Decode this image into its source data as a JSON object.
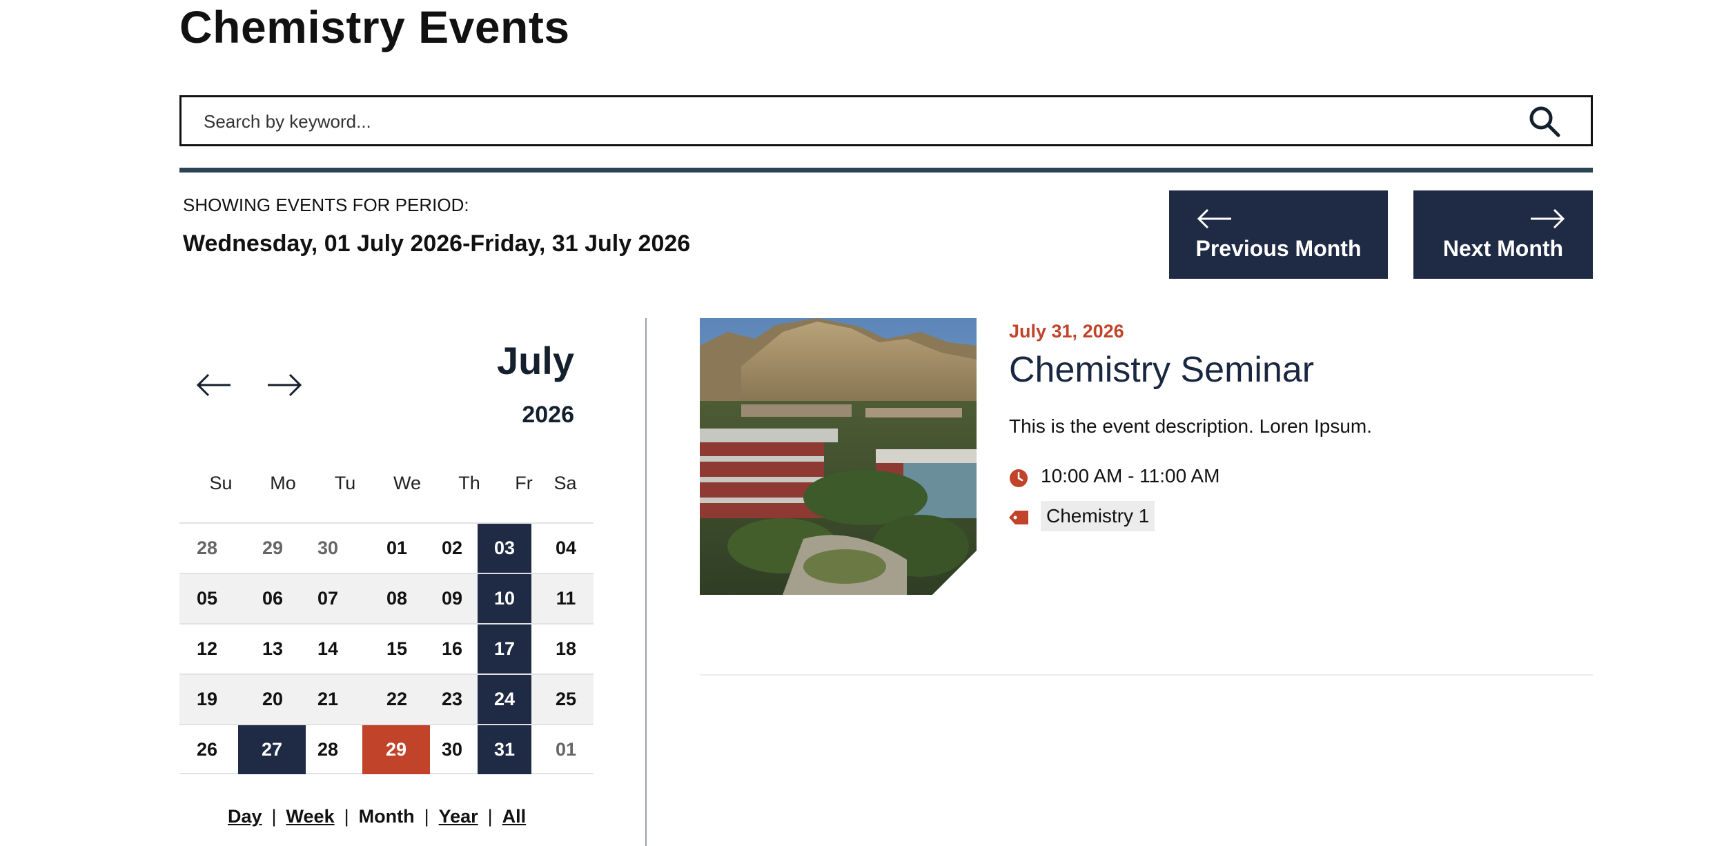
{
  "page": {
    "title": "Chemistry Events"
  },
  "search": {
    "placeholder": "Search by keyword..."
  },
  "period": {
    "label": "SHOWING EVENTS FOR PERIOD:",
    "range": "Wednesday, 01 July 2026-Friday, 31 July 2026"
  },
  "nav": {
    "prev_label": "Previous Month",
    "next_label": "Next Month"
  },
  "colors": {
    "navy": "#1f2a44",
    "accent": "#c0432a",
    "divider": "#2b4455"
  },
  "calendar": {
    "month": "July",
    "year": "2026",
    "weekdays": [
      "Su",
      "Mo",
      "Tu",
      "We",
      "Th",
      "Fr",
      "Sa"
    ],
    "weeks": [
      [
        {
          "d": "28",
          "other": true
        },
        {
          "d": "29",
          "other": true
        },
        {
          "d": "30",
          "other": true
        },
        {
          "d": "01"
        },
        {
          "d": "02"
        },
        {
          "d": "03",
          "hl": true
        },
        {
          "d": "04"
        }
      ],
      [
        {
          "d": "05"
        },
        {
          "d": "06"
        },
        {
          "d": "07"
        },
        {
          "d": "08"
        },
        {
          "d": "09"
        },
        {
          "d": "10",
          "hl": true
        },
        {
          "d": "11"
        }
      ],
      [
        {
          "d": "12"
        },
        {
          "d": "13"
        },
        {
          "d": "14"
        },
        {
          "d": "15"
        },
        {
          "d": "16"
        },
        {
          "d": "17",
          "hl": true
        },
        {
          "d": "18"
        }
      ],
      [
        {
          "d": "19"
        },
        {
          "d": "20"
        },
        {
          "d": "21"
        },
        {
          "d": "22"
        },
        {
          "d": "23"
        },
        {
          "d": "24",
          "hl": true
        },
        {
          "d": "25"
        }
      ],
      [
        {
          "d": "26"
        },
        {
          "d": "27",
          "hl": true
        },
        {
          "d": "28"
        },
        {
          "d": "29",
          "today": true
        },
        {
          "d": "30"
        },
        {
          "d": "31",
          "hl": true
        },
        {
          "d": "01",
          "other": true
        }
      ]
    ]
  },
  "views": {
    "day": "Day",
    "week": "Week",
    "month": "Month",
    "year": "Year",
    "all": "All",
    "separator": "|"
  },
  "event": {
    "date": "July 31, 2026",
    "title": "Chemistry Seminar",
    "description": "This is the event description. Loren Ipsum.",
    "time": "10:00 AM - 11:00 AM",
    "tag": "Chemistry 1"
  },
  "icons": {
    "search": "search-icon",
    "clock": "clock-icon",
    "tag": "tag-icon",
    "arrow_left": "arrow-left-icon",
    "arrow_right": "arrow-right-icon"
  }
}
